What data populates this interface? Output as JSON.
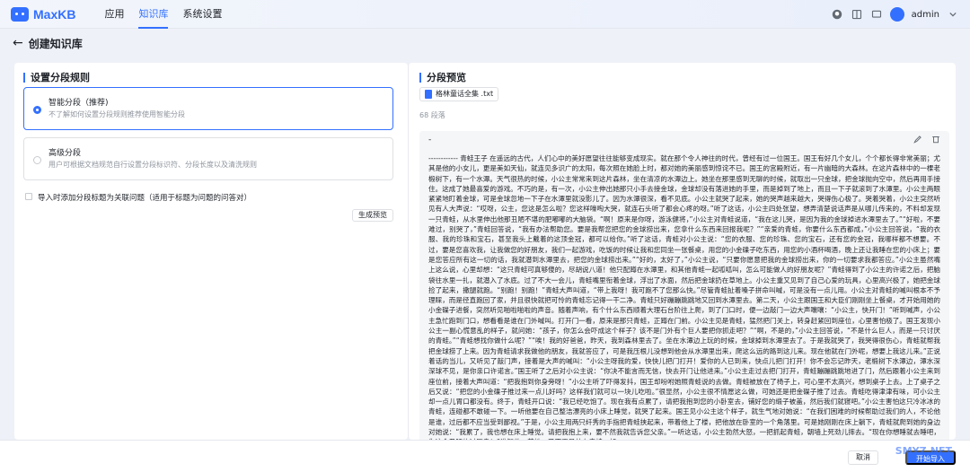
{
  "header": {
    "logo": "MaxKB",
    "nav": [
      "应用",
      "知识库",
      "系统设置"
    ],
    "active_nav": 1,
    "user": "admin",
    "icons": [
      "github-icon",
      "book-icon",
      "chat-icon",
      "user-avatar"
    ]
  },
  "page": {
    "back_icon": "←",
    "title": "创建知识库"
  },
  "left": {
    "section_title": "设置分段规则",
    "options": [
      {
        "title": "智能分段（推荐)",
        "desc": "不了解如何设置分段规则推荐使用智能分段",
        "selected": true
      },
      {
        "title": "高级分段",
        "desc": "用户可根据文档规范自行设置分段标识符、分段长度以及清洗规则",
        "selected": false
      }
    ],
    "checkbox_label": "导入时添加分段标题为关联问题（适用于标题为问题的问答对）",
    "checkbox_checked": false,
    "generate_button": "生成预览"
  },
  "right": {
    "section_title": "分段预览",
    "file_name": "格林童话全集 .txt",
    "segment_count": "68 段落",
    "segment_dash": "-",
    "segment_text": "------------ 青蛙王子 在遥远的古代，人们心中的美好愿望往往能够变成现实。就在那个令人神往的时代，曾经有过一位国王。国王有好几个女儿，个个都长得非常美丽；尤其是他的小女儿，更是美如天仙，就连见多识广的太阳，每次照在她脸上时，都对她的美丽感到惊诧不已。国王的宫殿附近，有一片幽暗的大森林。在这片森林中的一棵老椴树下，有一个水潭。天气很热的时候，小公主常常来到这片森林，坐在清凉的水潭边上。她坐在那里感到无聊的时候，就取出一只金球，把金球抛向空中，然后再用手接住。这成了她最喜爱的游戏。不巧的是，有一次，小公主伸出她那只小手去接金球，金球却没有落进她的手里，而是掉到了地上，而且一下子就滚到了水潭里。小公主两眼紧紧地盯着金球，可是金球忽地一下子在水潭里就没影儿了。因为水潭很深，看不见底。小公主就哭了起来，她的哭声越来越大，哭得伤心极了。哭着哭着，小公主突然听见有人大声说：“哎呀，公主，您这是怎么啦？您这样嚎啕大哭，就连石头听了都会心疼的呀。”听了这话，小公主四处张望，想弄清楚说话声是从哪儿传来的，不料却发现一只青蛙，从水里伸出他那丑陋不堪的肥嘟嘟的大脑袋。“啊！原来是你呀，游泳健将，”小公主对青蛙说道，“我在这儿哭，是因为我的金球掉进水潭里去了。”“好啦，不要难过，别哭了，”青蛙回答说，“我有办法帮助您。要是我帮您把您的金球捞出来，您拿什么东西来回报我呢？”“亲爱的青蛙，你要什么东西都成，”小公主回答说，“我的衣服、我的珍珠和宝石，甚至我头上戴着的这顶金冠，都可以给你。”听了这话，青蛙对小公主说：“您的衣服、您的珍珠、您的宝石，还有您的金冠，我哪样都不想要。不过，要是您喜欢我，让我做您的好朋友，我们一起游戏，吃饭的时候让我和您同坐一张餐桌，用您的小金碟子吃东西，用您的小酒杯喝酒，晚上还让我睡在您的小床上；要是您答应所有这一切的话，我就潜到水潭里去，把您的金球捞出来。”“好的，太好了，”小公主说，“只要你愿意把我的金球捞出来，你的一切要求我都答应。”小公主虽然嘴上这么说，心里却想：“这只青蛙可真够傻的，尽胡说八道！他只配蹲在水潭里，和其他青蛙一起呱呱叫，怎么可能做人的好朋友呢？”青蛙得到了小公主的许诺之后，把脑袋往水里一扎，就潜入了水底。过了不大一会儿，青蛙嘴里衔着金球，浮出了水面，然后把金球扔在草地上。小公主重又见到了自己心爱的玩具，心里高兴极了，她把金球捡了起来，撒腿就跑。“别跑！别跑！”青蛙大声叫道，“带上我呀！我可跑不了您那么快。”尽管青蛙扯着嗓子拼命叫喊，可是没有一点儿用。小公主对青蛙的喊叫根本不予理睬，而是径直跑回了家，并且很快就把可怜的青蛙忘记得一干二净。青蛙只好蹦蹦跳跳地又回到水潭里去。第二天，小公主跟国王和大臣们刚刚坐上餐桌，才开始用她的小金碟子进餐，突然听见啪啦啪啦的声音。随着声响，有个什么东西顺着大理石台阶往上爬，到了门口时，便一边敲门一边大声嚷嚷：“小公主，快开门！”听到喊声，小公主急忙跑到门口，想看看是谁在门外喊叫。打开门一看，原来是那只青蛙，正蹲在门前。小公主见是青蛙，猛然把门关上，转身赶紧回到座位，心里害怕极了。国王发现小公主一副心慌意乱的样子，就问她：“孩子，你怎么会吓成这个样子？该不是门外有个巨人要把你抓走吧？”“啊，不是的，”小公主回答说，“不是什么巨人，而是一只讨厌的青蛙。”“青蛙想找你做什么呢？”“唉！我的好爸爸，昨天，我到森林里去了。坐在水潭边上玩的时候，金球掉到水潭里去了。于是我就哭了，我哭得很伤心，青蛙就帮我把金球捞了上来。因为青蛙请求我做他的朋友，我就答应了，可是我压根儿没想到他会从水潭里出来，爬这么远的路到这儿来。现在他就在门外呢，想要上我这儿来。”正说着话的当儿，又听见了敲门声，接着是大声的喊叫：“小公主呀我的爱，快快儿把门打开！爱你的人已到来，快点儿把门打开！你不会忘记昨天，老椴树下水潭边，潭水深深球不见，是你亲口许诺言。”国王听了之后对小公主说：“你决不能言而无信，快去开门让他进来。”小公主走过去把门打开，青蛙蹦蹦跳跳地进了门，然后跟着小公主来到座位前，接着大声叫道：“把我抱到你身旁呀！”小公主听了吓得发抖，国王却吩咐她照青蛙说的去做。青蛙被放在了椅子上，可心里不太高兴，想到桌子上去。上了桌子之后又说：“把您的小金碟子推过来一点儿好吗？这样我们就可以一块儿吃啦。”很显然，小公主很不情愿这么做，可她还是把金碟子推了过去。青蛙吃得津津有味，可小公主却一点儿胃口都没有。终于，青蛙开口说：“我已经吃饱了。现在我有点累了，请把我抱到您的小卧室去，铺好您的缎子被盖，然后我们就寝吧。”小公主害怕这只冷冰冰的青蛙，连碰都不敢碰一下。一听他要在自己整洁漂亮的小床上睡觉，就哭了起来。国王见小公主这个样子，就生气地对她说：“在我们困难的时候帮助过我们的人，不论他是谁，过后都不应当受到鄙视。”于是，小公主用两只纤秀的手指把青蛙挟起来，带着他上了楼，把他放在卧室的一个角落里。可是她刚刚在床上躺下，青蛙就爬到她的身边对她说：“我累了，我也想在床上睡觉。请把我抱上来，要不然我就告诉您父亲。”一听这话，小公主勃然大怒，一把抓起青蛙，朝墙上死劲儿摔去。“现在你想睡就去睡吧，你这个丑陋的讨厌鬼！”谁知他一落地，已不再是什么青蛙，却"
  },
  "footer": {
    "cancel_button": "取消",
    "create_button": "开始导入"
  },
  "watermark": "SMYZ.NET",
  "colors": {
    "accent": "#3370ff",
    "background": "#eef1f7"
  }
}
